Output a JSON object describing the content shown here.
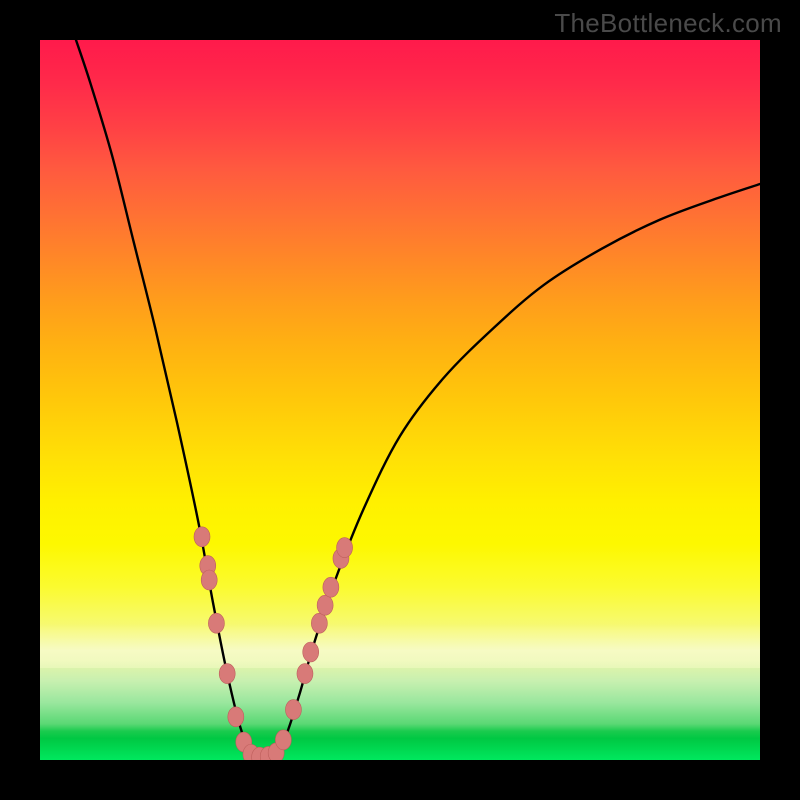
{
  "watermark": "TheBottleneck.com",
  "colors": {
    "curve_stroke": "#000000",
    "marker_fill": "#d87a78",
    "marker_stroke": "#be5f5c"
  },
  "chart_data": {
    "type": "line",
    "title": "",
    "xlabel": "",
    "ylabel": "",
    "xlim": [
      0,
      100
    ],
    "ylim": [
      0,
      100
    ],
    "curve": {
      "description": "V-shaped bottleneck curve (percent bottleneck vs component ratio). Minimum at x≈30, y≈0.",
      "minimum_x": 30,
      "minimum_y": 0,
      "points": [
        {
          "x": 5,
          "y": 100
        },
        {
          "x": 7,
          "y": 94
        },
        {
          "x": 10,
          "y": 84
        },
        {
          "x": 13,
          "y": 72
        },
        {
          "x": 16,
          "y": 60
        },
        {
          "x": 19,
          "y": 47
        },
        {
          "x": 22,
          "y": 33
        },
        {
          "x": 24,
          "y": 22
        },
        {
          "x": 26,
          "y": 12
        },
        {
          "x": 28,
          "y": 4
        },
        {
          "x": 30,
          "y": 0
        },
        {
          "x": 32,
          "y": 0
        },
        {
          "x": 34,
          "y": 3
        },
        {
          "x": 36,
          "y": 9
        },
        {
          "x": 38,
          "y": 16
        },
        {
          "x": 41,
          "y": 25
        },
        {
          "x": 45,
          "y": 35
        },
        {
          "x": 50,
          "y": 45
        },
        {
          "x": 56,
          "y": 53
        },
        {
          "x": 63,
          "y": 60
        },
        {
          "x": 70,
          "y": 66
        },
        {
          "x": 78,
          "y": 71
        },
        {
          "x": 86,
          "y": 75
        },
        {
          "x": 94,
          "y": 78
        },
        {
          "x": 100,
          "y": 80
        }
      ],
      "markers": [
        {
          "x": 22.5,
          "y": 31
        },
        {
          "x": 23.3,
          "y": 27
        },
        {
          "x": 23.5,
          "y": 25
        },
        {
          "x": 24.5,
          "y": 19
        },
        {
          "x": 26.0,
          "y": 12
        },
        {
          "x": 27.2,
          "y": 6
        },
        {
          "x": 28.3,
          "y": 2.5
        },
        {
          "x": 29.3,
          "y": 0.8
        },
        {
          "x": 30.5,
          "y": 0.4
        },
        {
          "x": 31.7,
          "y": 0.5
        },
        {
          "x": 32.8,
          "y": 1.0
        },
        {
          "x": 33.8,
          "y": 2.8
        },
        {
          "x": 35.2,
          "y": 7
        },
        {
          "x": 36.8,
          "y": 12
        },
        {
          "x": 37.6,
          "y": 15
        },
        {
          "x": 38.8,
          "y": 19
        },
        {
          "x": 39.6,
          "y": 21.5
        },
        {
          "x": 40.4,
          "y": 24
        },
        {
          "x": 41.8,
          "y": 28
        },
        {
          "x": 42.3,
          "y": 29.5
        }
      ]
    }
  }
}
